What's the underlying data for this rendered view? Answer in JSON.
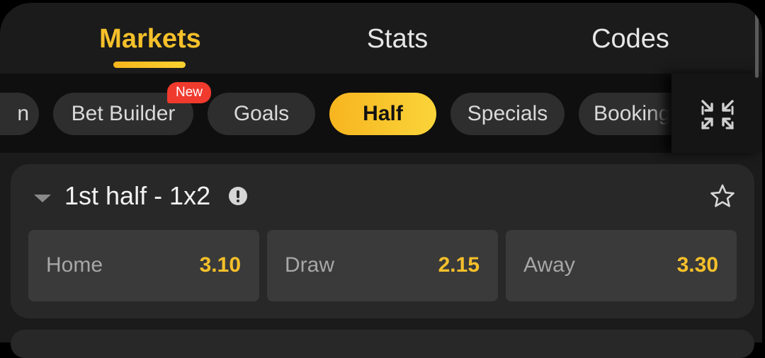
{
  "tabs": [
    {
      "label": "Markets",
      "active": true
    },
    {
      "label": "Stats",
      "active": false
    },
    {
      "label": "Codes",
      "active": false
    }
  ],
  "chips": [
    {
      "label": "n",
      "active": false
    },
    {
      "label": "Bet Builder",
      "active": false,
      "badge": "New"
    },
    {
      "label": "Goals",
      "active": false
    },
    {
      "label": "Half",
      "active": true
    },
    {
      "label": "Specials",
      "active": false
    },
    {
      "label": "Booking",
      "active": false
    }
  ],
  "icons": {
    "collapse": "collapse-arrows-icon",
    "caret": "caret-down-icon",
    "info": "info-icon",
    "favorite": "star-icon"
  },
  "market": {
    "title": "1st half - 1x2",
    "outcomes": [
      {
        "label": "Home",
        "odds": "3.10"
      },
      {
        "label": "Draw",
        "odds": "2.15"
      },
      {
        "label": "Away",
        "odds": "3.30"
      }
    ]
  },
  "colors": {
    "accent": "#f6c02a",
    "badge": "#f03a2e",
    "panel": "#1b1b1b",
    "card": "#282828"
  }
}
